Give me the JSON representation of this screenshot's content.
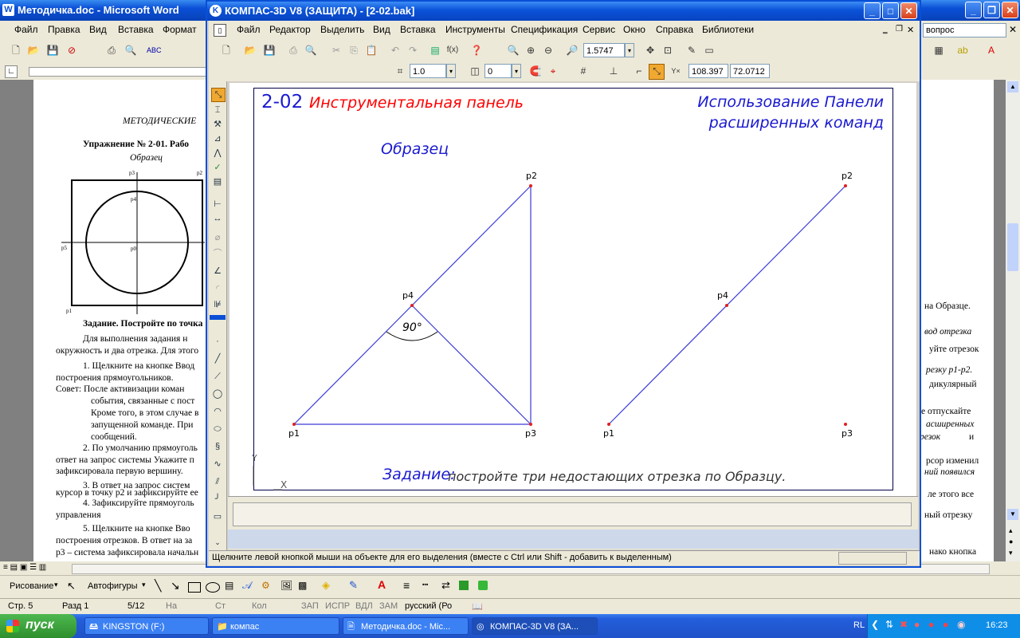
{
  "word": {
    "title": "Методичка.doc - Microsoft Word",
    "menu": [
      "Файл",
      "Правка",
      "Вид",
      "Вставка",
      "Формат"
    ],
    "question_box": "вопрос",
    "doc": {
      "header": "МЕТОДИЧЕСКИЕ",
      "exercise": "Упражнение № 2-01. Рабо",
      "sample": "Образец",
      "lines": [
        "Задание. Постройте по точка",
        "Для выполнения задания н",
        "окружность и два отрезка. Для этого",
        "1. Щелкните на кнопке Ввод",
        "построения прямоугольников.",
        "Совет: После активизации коман",
        "события, связанные с пост",
        "Кроме того, в этом случае в",
        "запущенной команде. При",
        "сообщений.",
        "2. По умолчанию прямоуголь",
        "ответ на запрос системы Укажите п",
        "зафиксировала первую вершину.",
        "3. В ответ на запрос систем",
        "курсор в точку p2 и зафиксируйте ее",
        "4. Зафиксируйте прямоуголь",
        "управления",
        "5. Щелкните на кнопке Вво",
        "построения отрезков. В ответ на за",
        "p3 – система зафиксировала начальн"
      ],
      "right_lines": [
        "на Образце.",
        "вод отрезка",
        "уйте отрезок",
        "резку p1-p2.",
        "дикулярный",
        "е отпускайте",
        "асширенных",
        "резок",
        "и",
        "рсор изменил",
        "ний появился",
        "ле этого все",
        "ный отрезку",
        "нако кнопка"
      ],
      "figure_labels": [
        "p3",
        "p2",
        "p5",
        "p4",
        "p1",
        "p0"
      ]
    },
    "draw_toolbar": {
      "drawing": "Рисование",
      "autoshapes": "Автофигуры"
    },
    "status": {
      "page": "Стр. 5",
      "section": "Разд 1",
      "pages": "5/12",
      "at": "На",
      "line": "Ст",
      "col": "Кол",
      "rec": "ЗАП",
      "trk": "ИСПР",
      "ext": "ВДЛ",
      "ovr": "ЗАМ",
      "lang": "русский (Ро"
    }
  },
  "kompas": {
    "title": "КОМПАС-3D V8 (ЗАЩИТА) - [2-02.bak]",
    "menu": [
      "Файл",
      "Редактор",
      "Выделить",
      "Вид",
      "Вставка",
      "Инструменты",
      "Спецификация",
      "Сервис",
      "Окно",
      "Справка",
      "Библиотеки"
    ],
    "zoom": "1.5747",
    "step": "1.0",
    "layer": "0",
    "coord_x": "108.397",
    "coord_y": "72.0712",
    "drawing": {
      "code": "2-02",
      "panel_title": "Инструментальная панель",
      "right_title_1": "Использование Панели",
      "right_title_2": "расширенных команд",
      "sample": "Образец",
      "angle": "90°",
      "task_label": "Задание:",
      "task_text": "постройте три недостающих отрезка по Образцу.",
      "points": [
        "p1",
        "p2",
        "p3",
        "p4"
      ],
      "axis_y": "Y",
      "axis_x": "X"
    },
    "status_text": "Щелкните левой кнопкой мыши на объекте для его выделения (вместе с Ctrl или Shift - добавить к выделенным)"
  },
  "taskbar": {
    "start": "пуск",
    "buttons": [
      "KINGSTON (F:)",
      "компас",
      "Методичка.doc - Mic...",
      "КОМПАС-3D V8 (ЗА..."
    ],
    "lang": "RL",
    "clock": "16:23"
  },
  "colors": {
    "xp_blue": "#0a4fd6",
    "drawing_red": "#ff0000",
    "drawing_blue": "#1a1ad0",
    "geometry_blue": "#3a3ad8",
    "point_red": "#e02020"
  }
}
